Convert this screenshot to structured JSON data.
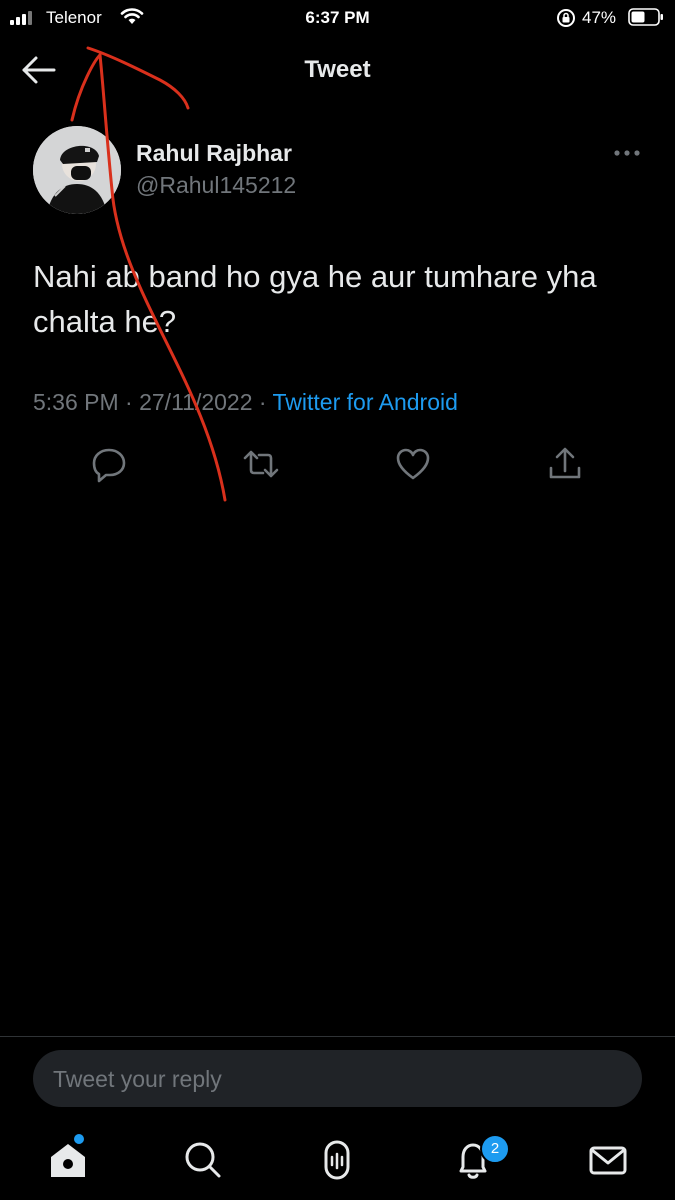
{
  "status_bar": {
    "carrier": "Telenor",
    "time": "6:37 PM",
    "battery_percent": "47%",
    "icons": [
      "signal-icon",
      "wifi-icon",
      "orientation-lock-icon",
      "battery-icon"
    ]
  },
  "header": {
    "title": "Tweet",
    "back_icon": "back-arrow-icon"
  },
  "tweet": {
    "author_name": "Rahul Rajbhar",
    "author_handle": "@Rahul145212",
    "text": "Nahi ab band ho gya he aur tumhare yha chalta he?",
    "timestamp": "5:36 PM · 27/11/2022 · ",
    "source": "Twitter for Android",
    "actions": [
      "reply-icon",
      "retweet-icon",
      "like-icon",
      "share-icon"
    ]
  },
  "reply": {
    "placeholder": "Tweet your reply"
  },
  "tab_bar": {
    "tabs": [
      "home-icon",
      "search-icon",
      "spaces-icon",
      "notifications-icon",
      "messages-icon"
    ],
    "notification_count": "2"
  },
  "colors": {
    "background": "#000000",
    "text_primary": "#e7e9ea",
    "text_secondary": "#71767b",
    "accent": "#1d9bf0",
    "annotation": "#d9301c"
  }
}
